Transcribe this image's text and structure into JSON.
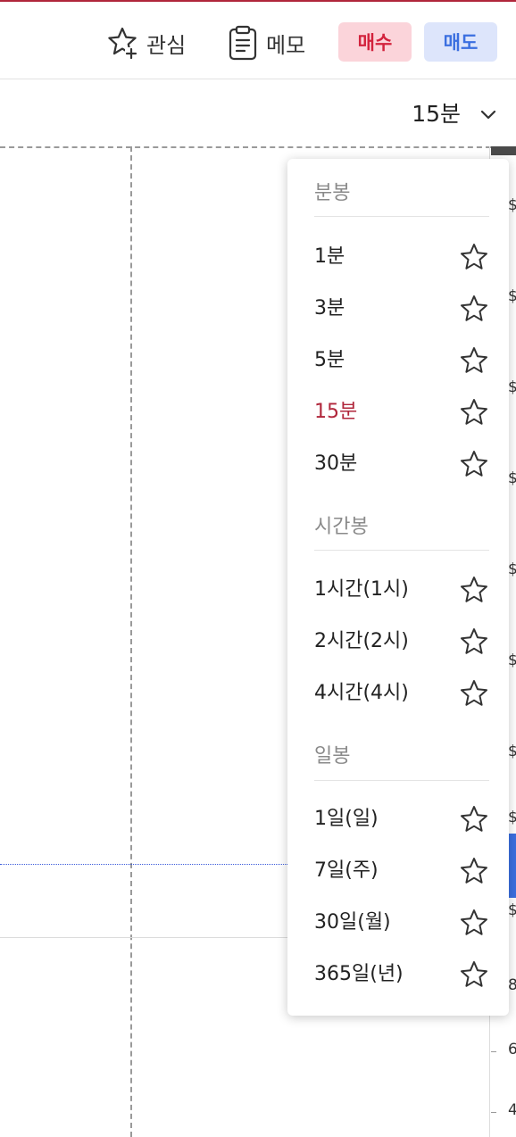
{
  "header": {
    "watchlist_label": "관심",
    "memo_label": "메모",
    "buy_label": "매수",
    "sell_label": "매도"
  },
  "interval": {
    "current": "15분"
  },
  "dropdown": {
    "minute_section": "분봉",
    "minute_options": [
      "1분",
      "3분",
      "5분",
      "15분",
      "30분"
    ],
    "hour_section": "시간봉",
    "hour_options": [
      "1시간(1시)",
      "2시간(2시)",
      "4시간(4시)"
    ],
    "day_section": "일봉",
    "day_options": [
      "1일(일)",
      "7일(주)",
      "30일(월)",
      "365일(년)"
    ],
    "selected": "15분"
  },
  "chart_axis": {
    "labels": [
      "$",
      "$",
      "$",
      "$",
      "$",
      "$",
      "$",
      "$",
      "$",
      "8",
      "6",
      "4"
    ]
  },
  "colors": {
    "accent": "#b0263b",
    "buy_bg": "#fbd4da",
    "buy_text": "#d3233d",
    "sell_bg": "#dde5fb",
    "sell_text": "#3b6fe0"
  },
  "icons": {
    "watchlist": "star-plus-icon",
    "memo": "clipboard-icon",
    "dropdown": "chevron-down-icon",
    "favorite": "star-outline-icon"
  }
}
